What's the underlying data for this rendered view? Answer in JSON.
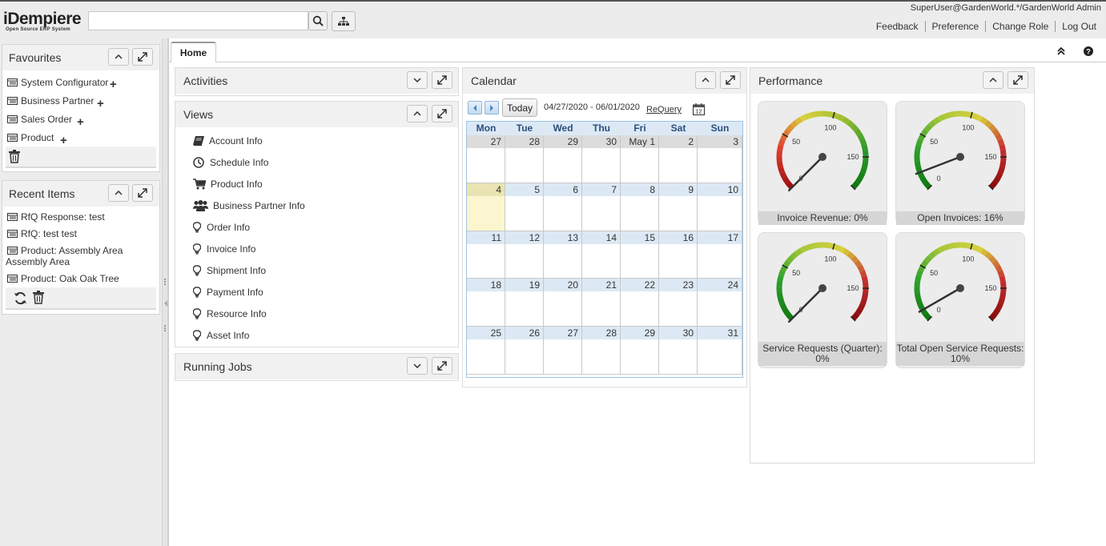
{
  "header": {
    "logo_main": "iDempiere",
    "logo_sub": "Open Source ERP System",
    "search_placeholder": "",
    "user": "SuperUser@GardenWorld.*/GardenWorld Admin",
    "links": [
      "Feedback",
      "Preference",
      "Change Role",
      "Log Out"
    ]
  },
  "favourites": {
    "title": "Favourites",
    "items": [
      {
        "label": "System Configurator"
      },
      {
        "label": "Business Partner"
      },
      {
        "label": "Sales Order"
      },
      {
        "label": "Product"
      }
    ]
  },
  "recent": {
    "title": "Recent Items",
    "items": [
      {
        "label": "RfQ Response: test"
      },
      {
        "label": "RfQ: test test"
      },
      {
        "label": "Product: Assembly Area Assembly Area"
      },
      {
        "label": "Product: Oak Oak Tree"
      }
    ]
  },
  "tabs": [
    {
      "label": "Home"
    }
  ],
  "activities": {
    "title": "Activities"
  },
  "views": {
    "title": "Views",
    "items": [
      {
        "label": "Account Info",
        "icon": "book-icon"
      },
      {
        "label": "Schedule Info",
        "icon": "clock-icon"
      },
      {
        "label": "Product Info",
        "icon": "cart-icon"
      },
      {
        "label": "Business Partner Info",
        "icon": "people-icon"
      },
      {
        "label": "Order Info",
        "icon": "bulb-icon"
      },
      {
        "label": "Invoice Info",
        "icon": "bulb-icon"
      },
      {
        "label": "Shipment Info",
        "icon": "bulb-icon"
      },
      {
        "label": "Payment Info",
        "icon": "bulb-icon"
      },
      {
        "label": "Resource Info",
        "icon": "bulb-icon"
      },
      {
        "label": "Asset Info",
        "icon": "bulb-icon"
      }
    ]
  },
  "running_jobs": {
    "title": "Running Jobs"
  },
  "calendar": {
    "title": "Calendar",
    "today_label": "Today",
    "range": "04/27/2020 - 06/01/2020",
    "requery_label": "ReQuery",
    "days_of_week": [
      "Mon",
      "Tue",
      "Wed",
      "Thu",
      "Fri",
      "Sat",
      "Sun"
    ],
    "weeks": [
      [
        "27",
        "28",
        "29",
        "30",
        "May 1",
        "2",
        "3"
      ],
      [
        "4",
        "5",
        "6",
        "7",
        "8",
        "9",
        "10"
      ],
      [
        "11",
        "12",
        "13",
        "14",
        "15",
        "16",
        "17"
      ],
      [
        "18",
        "19",
        "20",
        "21",
        "22",
        "23",
        "24"
      ],
      [
        "25",
        "26",
        "27",
        "28",
        "29",
        "30",
        "31"
      ]
    ]
  },
  "performance": {
    "title": "Performance",
    "gauges": [
      {
        "label": "Invoice Revenue: 0%",
        "value": 0,
        "scheme": "red-green"
      },
      {
        "label": "Open Invoices: 16%",
        "value": 16,
        "scheme": "green-red"
      },
      {
        "label": "Service Requests (Quarter): 0%",
        "value": 0,
        "scheme": "green-red"
      },
      {
        "label": "Total Open Service Requests: 10%",
        "value": 10,
        "scheme": "green-red"
      }
    ],
    "tick_labels": [
      "0",
      "50",
      "100",
      "150"
    ]
  }
}
